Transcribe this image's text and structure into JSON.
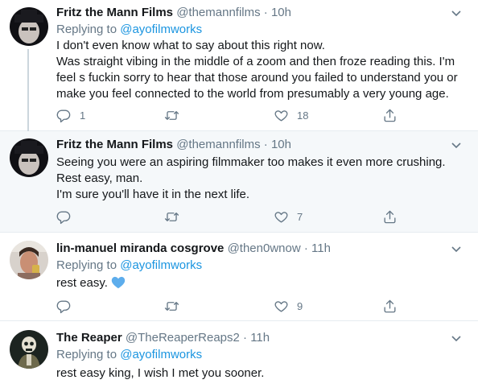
{
  "tweets": [
    {
      "name": "Fritz the Mann Films",
      "handle": "@themannfilms",
      "sep": "·",
      "time": "10h",
      "reply_prefix": "Replying to ",
      "reply_to": "@ayofilmworks",
      "lines": [
        "I don't even know what to say about this right now.",
        "Was straight vibing in the middle of a zoom and then froze reading this. I'm",
        "feel s fuckin sorry to hear that those around you failed to understand you or",
        "make you feel connected to the world from presumably a very young age."
      ],
      "replies": "1",
      "retweets": "",
      "likes": "18"
    },
    {
      "name": "Fritz the Mann Films",
      "handle": "@themannfilms",
      "sep": "·",
      "time": "10h",
      "lines": [
        "Seeing you were an aspiring filmmaker too makes it even more crushing.",
        "Rest easy, man.",
        "I'm sure you'll have it in the next life."
      ],
      "replies": "",
      "retweets": "",
      "likes": "7"
    },
    {
      "name": "lin-manuel miranda cosgrove",
      "handle": "@then0wnow",
      "sep": "·",
      "time": "11h",
      "reply_prefix": "Replying to ",
      "reply_to": "@ayofilmworks",
      "lines": [
        "rest easy."
      ],
      "replies": "",
      "retweets": "",
      "likes": "9"
    },
    {
      "name": "The Reaper",
      "handle": "@TheReaperReaps2",
      "sep": "·",
      "time": "11h",
      "reply_prefix": "Replying to ",
      "reply_to": "@ayofilmworks",
      "lines": [
        "rest easy king, I wish I met you sooner."
      ]
    }
  ],
  "colors": {
    "link": "#1b95e0",
    "muted": "#657786",
    "highlight_bg": "#f5f8fa",
    "heart_emoji": "#5dadec"
  },
  "icons": {
    "reply": "reply-icon",
    "retweet": "retweet-icon",
    "like": "like-icon",
    "share": "share-icon",
    "more": "chevron-down-icon",
    "emoji": "blue-heart-emoji"
  }
}
